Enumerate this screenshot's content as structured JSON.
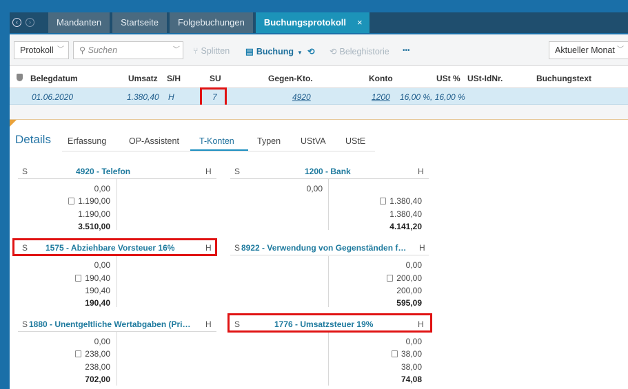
{
  "tabs": {
    "mandanten": "Mandanten",
    "startseite": "Startseite",
    "folgebuchungen": "Folgebuchungen",
    "buchungsprotokoll": "Buchungsprotokoll",
    "close": "×"
  },
  "toolbar": {
    "protokoll": "Protokoll",
    "search_placeholder": "Suchen",
    "splitten": "Splitten",
    "buchung": "Buchung",
    "beleghistorie": "Beleghistorie",
    "more": "•••",
    "period": "Aktueller Monat"
  },
  "table": {
    "headers": {
      "belegdatum": "Belegdatum",
      "umsatz": "Umsatz",
      "sh": "S/H",
      "su": "SU",
      "gegenkto": "Gegen-Kto.",
      "konto": "Konto",
      "ust": "USt %",
      "ustidnr": "USt-IdNr.",
      "buchungstext": "Buchungstext"
    },
    "row": {
      "belegdatum": "01.06.2020",
      "umsatz": "1.380,40",
      "sh": "H",
      "su": "7",
      "gegenkto": "4920",
      "konto": "1200",
      "ust": "16,00 %, 16,00 %"
    }
  },
  "details": {
    "title": "Details",
    "tabs": [
      "Erfassung",
      "OP-Assistent",
      "T-Konten",
      "Typen",
      "UStVA",
      "UStE"
    ]
  },
  "tkonten": {
    "s": "S",
    "h": "H",
    "accounts": [
      {
        "title": "4920 - Telefon",
        "values": [
          "0,00",
          "1.190,00",
          "1.190,00",
          "3.510,00"
        ]
      },
      {
        "title": "1200 - Bank",
        "values": [
          "0,00",
          "1.380,40",
          "1.380,40",
          "4.141,20"
        ]
      },
      {
        "title": "1575 - Abziehbare Vorsteuer 16%",
        "values": [
          "0,00",
          "190,40",
          "190,40",
          "190,40"
        ]
      },
      {
        "title": "8922 - Verwendung von Gegenständen f…",
        "values": [
          "0,00",
          "200,00",
          "200,00",
          "595,09"
        ]
      },
      {
        "title": "1880 - Unentgeltliche Wertabgaben (Pri…",
        "values": [
          "0,00",
          "238,00",
          "238,00",
          "702,00"
        ]
      },
      {
        "title": "1776 - Umsatzsteuer 19%",
        "values": [
          "0,00",
          "38,00",
          "38,00",
          "74,08"
        ]
      }
    ]
  }
}
